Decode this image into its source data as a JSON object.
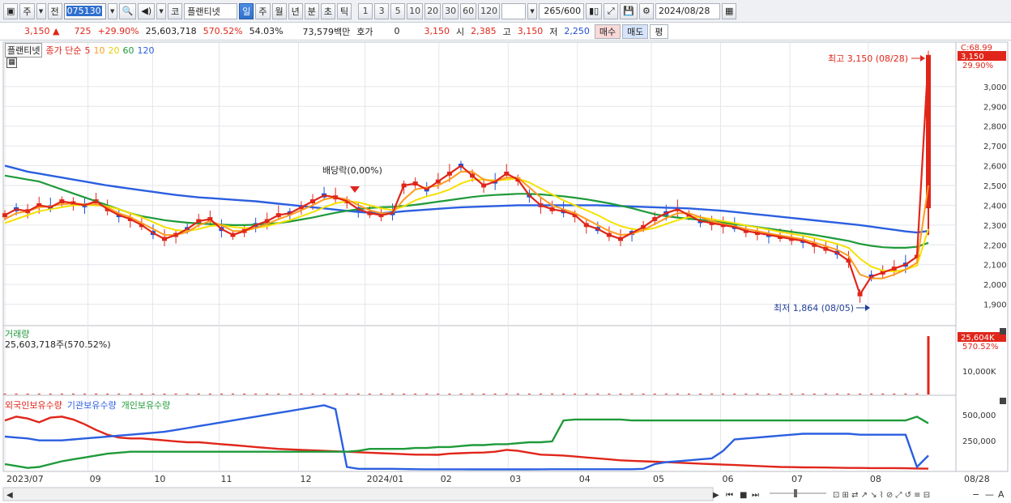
{
  "toolbar": {
    "market_btn": "주",
    "prev_btn": "전",
    "stock_code": "075130",
    "stock_market": "코",
    "stock_name": "플랜티넷",
    "periods": [
      "일",
      "주",
      "월",
      "년",
      "분",
      "초",
      "틱"
    ],
    "selected_period": "일",
    "intervals": [
      "1",
      "3",
      "5",
      "10",
      "20",
      "30",
      "60",
      "120"
    ],
    "count": "265",
    "count_total": "/600",
    "date": "2024/08/28"
  },
  "quote": {
    "price": "3,150",
    "change": "725",
    "change_pct": "+29.90%",
    "volume": "25,603,718",
    "volume_ratio": "570.52%",
    "turnover": "54.03%",
    "amount": "73,579백만",
    "hoga_label": "호가",
    "hoga_value": "0",
    "hoga_price": "3,150",
    "open_label": "시",
    "open": "2,385",
    "high_label": "고",
    "high": "3,150",
    "low_label": "저",
    "low": "2,250",
    "buy_label": "매수",
    "sell_label": "매도",
    "avg_label": "평"
  },
  "legend": {
    "stock": "플랜티넷",
    "ma_label": "종가 단순",
    "ma": [
      {
        "name": "5",
        "color": "#e0261a"
      },
      {
        "name": "10",
        "color": "#ff9b1f"
      },
      {
        "name": "20",
        "color": "#f5e100"
      },
      {
        "name": "60",
        "color": "#1f9a3a"
      },
      {
        "name": "120",
        "color": "#2b5fe0"
      }
    ]
  },
  "annotations": {
    "high": "최고 3,150 (08/28)",
    "low": "최저 1,864 (08/05)",
    "dividend": "배당락(0,00%)",
    "last_c": "C:68.99",
    "last_price": "3,150",
    "last_pct": "29.90%"
  },
  "volume_panel": {
    "title": "거래량",
    "value": "25,603,718주(570.52%)",
    "tag_value": "25,604K",
    "tag_pct": "570.52%",
    "axis_label": "10,000K"
  },
  "investor_panel": {
    "series": [
      {
        "name": "외국인보유수량",
        "color": "#e0261a"
      },
      {
        "name": "기관보유수량",
        "color": "#2b5fe0"
      },
      {
        "name": "개인보유수량",
        "color": "#1f9a3a"
      }
    ],
    "axis_labels": [
      "500,000",
      "250,000"
    ]
  },
  "price_axis": [
    "3,000",
    "2,900",
    "2,800",
    "2,700",
    "2,600",
    "2,500",
    "2,400",
    "2,300",
    "2,200",
    "2,100",
    "2,000",
    "1,900"
  ],
  "x_axis": [
    "2023/07",
    "09",
    "10",
    "11",
    "12",
    "2024/01",
    "02",
    "03",
    "04",
    "05",
    "06",
    "07",
    "08",
    "08/28"
  ],
  "chart_data": {
    "type": "line",
    "title": "",
    "ylim": [
      1800,
      3200
    ],
    "ma_series": [
      {
        "name": "5",
        "color": "#e0261a",
        "values": [
          2350,
          2380,
          2370,
          2400,
          2390,
          2420,
          2410,
          2400,
          2420,
          2380,
          2350,
          2330,
          2300,
          2260,
          2230,
          2250,
          2280,
          2320,
          2330,
          2280,
          2250,
          2270,
          2300,
          2320,
          2350,
          2360,
          2390,
          2420,
          2450,
          2440,
          2420,
          2380,
          2360,
          2350,
          2360,
          2500,
          2510,
          2480,
          2520,
          2560,
          2600,
          2550,
          2500,
          2520,
          2560,
          2530,
          2450,
          2400,
          2380,
          2370,
          2350,
          2300,
          2280,
          2250,
          2230,
          2260,
          2290,
          2330,
          2360,
          2380,
          2350,
          2320,
          2310,
          2300,
          2290,
          2270,
          2260,
          2250,
          2240,
          2230,
          2220,
          2200,
          2180,
          2160,
          2120,
          1950,
          2040,
          2060,
          2080,
          2100,
          2140,
          3150
        ]
      },
      {
        "name": "10",
        "color": "#ff9b1f",
        "values": [
          2330,
          2360,
          2370,
          2390,
          2395,
          2405,
          2410,
          2405,
          2405,
          2390,
          2360,
          2340,
          2310,
          2280,
          2250,
          2250,
          2265,
          2300,
          2320,
          2300,
          2270,
          2270,
          2285,
          2305,
          2330,
          2350,
          2375,
          2400,
          2430,
          2440,
          2430,
          2400,
          2375,
          2360,
          2360,
          2430,
          2480,
          2490,
          2500,
          2530,
          2570,
          2570,
          2530,
          2520,
          2540,
          2540,
          2490,
          2440,
          2400,
          2380,
          2360,
          2330,
          2300,
          2270,
          2250,
          2255,
          2275,
          2305,
          2335,
          2360,
          2360,
          2340,
          2320,
          2305,
          2295,
          2280,
          2270,
          2258,
          2248,
          2238,
          2228,
          2212,
          2194,
          2175,
          2145,
          2050,
          2030,
          2030,
          2050,
          2075,
          2110,
          2500
        ]
      },
      {
        "name": "20",
        "color": "#f5e100",
        "values": [
          2310,
          2330,
          2350,
          2370,
          2380,
          2390,
          2400,
          2400,
          2400,
          2395,
          2380,
          2360,
          2340,
          2315,
          2290,
          2275,
          2270,
          2280,
          2295,
          2300,
          2290,
          2285,
          2285,
          2295,
          2310,
          2325,
          2345,
          2365,
          2390,
          2410,
          2420,
          2415,
          2400,
          2385,
          2375,
          2395,
          2425,
          2445,
          2460,
          2480,
          2510,
          2530,
          2530,
          2525,
          2530,
          2535,
          2515,
          2485,
          2455,
          2425,
          2400,
          2375,
          2350,
          2320,
          2295,
          2280,
          2275,
          2285,
          2305,
          2325,
          2340,
          2340,
          2330,
          2320,
          2310,
          2298,
          2288,
          2277,
          2266,
          2256,
          2246,
          2234,
          2220,
          2205,
          2185,
          2130,
          2090,
          2070,
          2065,
          2075,
          2095,
          2280
        ]
      },
      {
        "name": "60",
        "color": "#1f9a3a",
        "values": [
          2550,
          2540,
          2530,
          2520,
          2500,
          2480,
          2460,
          2440,
          2420,
          2400,
          2380,
          2360,
          2345,
          2335,
          2325,
          2318,
          2312,
          2308,
          2305,
          2302,
          2300,
          2300,
          2302,
          2305,
          2310,
          2318,
          2328,
          2338,
          2350,
          2362,
          2372,
          2380,
          2386,
          2390,
          2392,
          2396,
          2402,
          2410,
          2418,
          2426,
          2434,
          2442,
          2448,
          2452,
          2455,
          2458,
          2458,
          2455,
          2450,
          2445,
          2438,
          2430,
          2420,
          2410,
          2398,
          2385,
          2370,
          2355,
          2345,
          2338,
          2332,
          2326,
          2320,
          2312,
          2305,
          2298,
          2290,
          2282,
          2274,
          2266,
          2258,
          2250,
          2240,
          2230,
          2220,
          2205,
          2195,
          2188,
          2185,
          2185,
          2190,
          2210
        ]
      },
      {
        "name": "120",
        "color": "#2b5fe0",
        "values": [
          2600,
          2585,
          2570,
          2560,
          2550,
          2540,
          2530,
          2520,
          2510,
          2500,
          2492,
          2484,
          2476,
          2468,
          2460,
          2452,
          2446,
          2440,
          2436,
          2432,
          2428,
          2424,
          2420,
          2414,
          2408,
          2402,
          2396,
          2390,
          2384,
          2378,
          2372,
          2366,
          2362,
          2360,
          2364,
          2370,
          2374,
          2378,
          2382,
          2386,
          2390,
          2392,
          2394,
          2396,
          2398,
          2400,
          2400,
          2400,
          2400,
          2400,
          2400,
          2400,
          2400,
          2398,
          2396,
          2394,
          2392,
          2390,
          2388,
          2386,
          2384,
          2380,
          2376,
          2372,
          2366,
          2360,
          2354,
          2348,
          2342,
          2336,
          2330,
          2324,
          2318,
          2312,
          2306,
          2300,
          2292,
          2284,
          2276,
          2268,
          2262,
          2270
        ]
      }
    ],
    "volume": [
      1,
      1,
      1,
      2,
      1,
      1,
      1,
      1,
      1,
      1,
      1,
      1,
      1,
      1,
      1,
      1,
      1,
      1,
      1,
      1,
      1,
      1,
      1,
      1,
      1,
      1,
      1,
      2,
      1,
      1,
      1,
      1,
      1,
      1,
      1,
      2,
      1,
      1,
      1,
      1,
      1,
      1,
      1,
      1,
      1,
      1,
      1,
      1,
      1,
      1,
      1,
      1,
      1,
      1,
      1,
      1,
      1,
      1,
      1,
      1,
      1,
      1,
      1,
      1,
      1,
      1,
      1,
      1,
      1,
      1,
      1,
      1,
      1,
      1,
      1,
      1,
      1,
      1,
      1,
      1,
      6,
      25604
    ],
    "investor": [
      {
        "name": "외국인보유수량",
        "color": "#e0261a",
        "values": [
          520,
          560,
          540,
          500,
          550,
          560,
          530,
          480,
          420,
          370,
          340,
          330,
          330,
          320,
          310,
          300,
          290,
          290,
          280,
          270,
          260,
          250,
          240,
          230,
          220,
          215,
          210,
          205,
          200,
          195,
          190,
          185,
          180,
          175,
          170,
          165,
          160,
          160,
          158,
          170,
          175,
          180,
          182,
          190,
          210,
          200,
          180,
          160,
          155,
          150,
          140,
          130,
          120,
          110,
          100,
          95,
          90,
          85,
          80,
          75,
          70,
          65,
          60,
          55,
          50,
          45,
          40,
          35,
          30,
          28,
          26,
          25,
          24,
          22,
          20,
          20,
          18,
          18,
          18,
          16,
          14,
          12
        ]
      },
      {
        "name": "기관보유수량",
        "color": "#2b5fe0",
        "values": [
          350,
          340,
          330,
          310,
          310,
          310,
          320,
          330,
          340,
          350,
          360,
          370,
          380,
          390,
          400,
          420,
          440,
          460,
          480,
          500,
          520,
          540,
          560,
          580,
          600,
          620,
          640,
          660,
          680,
          640,
          30,
          10,
          10,
          10,
          10,
          8,
          6,
          5,
          5,
          5,
          5,
          4,
          4,
          4,
          4,
          4,
          4,
          5,
          6,
          6,
          6,
          6,
          6,
          6,
          6,
          6,
          10,
          60,
          80,
          90,
          100,
          110,
          120,
          200,
          320,
          330,
          340,
          350,
          360,
          370,
          380,
          380,
          380,
          380,
          380,
          370,
          370,
          370,
          370,
          370,
          30,
          150
        ]
      },
      {
        "name": "개인보유수량",
        "color": "#1f9a3a",
        "values": [
          60,
          40,
          20,
          30,
          60,
          90,
          110,
          130,
          150,
          170,
          180,
          190,
          190,
          190,
          190,
          190,
          190,
          190,
          190,
          190,
          190,
          190,
          190,
          190,
          190,
          190,
          190,
          190,
          190,
          190,
          190,
          200,
          220,
          220,
          220,
          220,
          230,
          230,
          240,
          240,
          250,
          260,
          260,
          270,
          270,
          280,
          290,
          290,
          300,
          520,
          530,
          530,
          530,
          530,
          530,
          520,
          520,
          520,
          520,
          520,
          520,
          520,
          520,
          520,
          520,
          520,
          520,
          520,
          520,
          520,
          520,
          520,
          520,
          520,
          520,
          520,
          520,
          520,
          520,
          520,
          560,
          490
        ]
      }
    ]
  }
}
